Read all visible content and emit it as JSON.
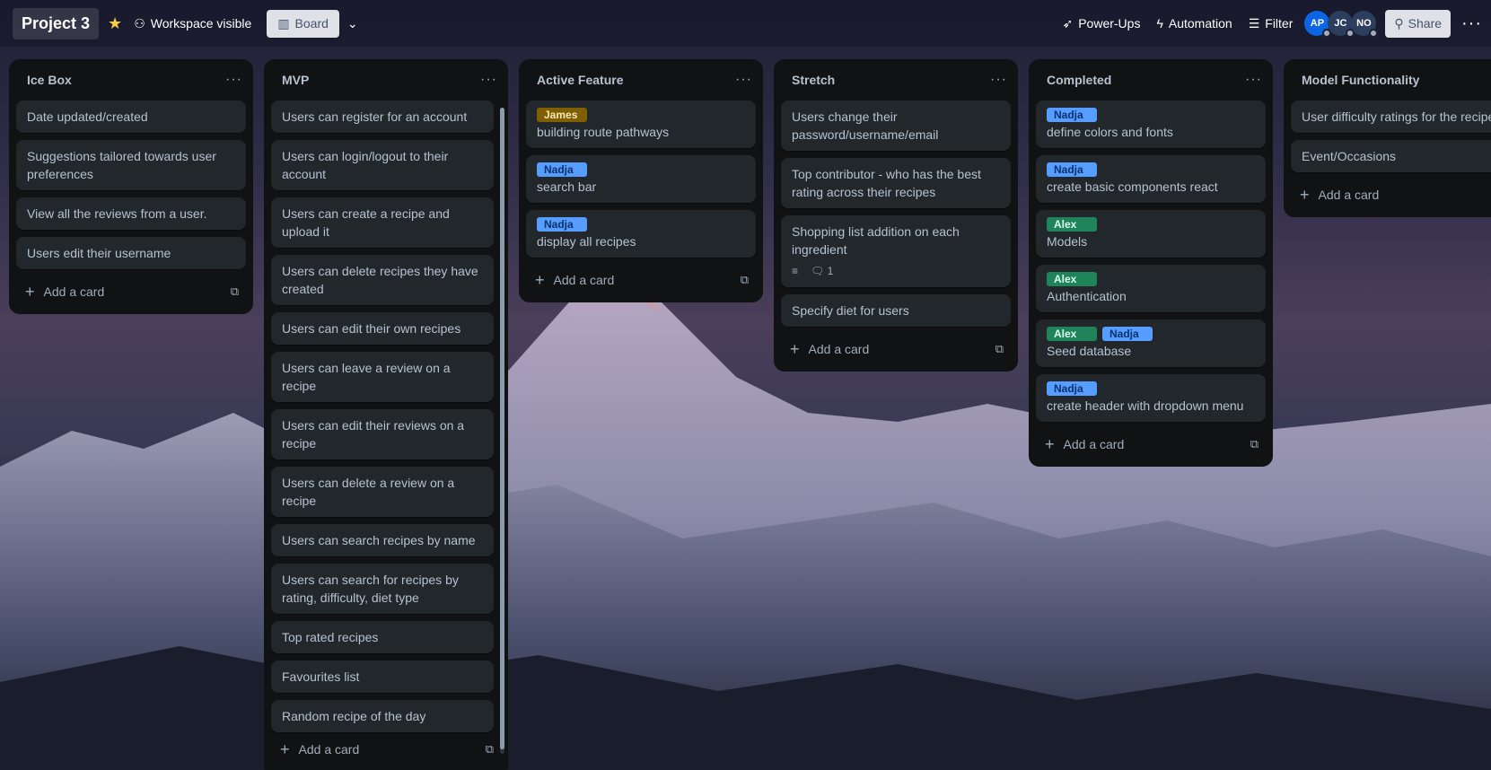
{
  "topbar": {
    "board_title": "Project 3",
    "star_icon": "star-icon",
    "visibility_label": "Workspace visible",
    "view_label": "Board",
    "powerups_label": "Power-Ups",
    "automation_label": "Automation",
    "filter_label": "Filter",
    "share_label": "Share",
    "avatars": [
      {
        "initials": "AP",
        "color": "#0c66e4"
      },
      {
        "initials": "JC",
        "color": "#2c3e5d"
      },
      {
        "initials": "NO",
        "color": "#2c3e5d"
      }
    ]
  },
  "labels": {
    "James": "#7f5f01",
    "Nadja": "#579dff",
    "Alex": "#1f845a"
  },
  "add_card_label": "Add a card",
  "lists": [
    {
      "title": "Ice Box",
      "cards": [
        {
          "text": "Date updated/created"
        },
        {
          "text": "Suggestions tailored towards user preferences"
        },
        {
          "text": "View all the reviews from a user."
        },
        {
          "text": "Users edit their username"
        }
      ]
    },
    {
      "title": "MVP",
      "cards": [
        {
          "text": "Users can register for an account"
        },
        {
          "text": "Users can login/logout to their account"
        },
        {
          "text": "Users can create a recipe and upload it"
        },
        {
          "text": "Users can delete recipes they have created"
        },
        {
          "text": "Users can edit their own recipes"
        },
        {
          "text": "Users can leave a review on a recipe"
        },
        {
          "text": "Users can edit their reviews on a recipe"
        },
        {
          "text": "Users can delete a review on a recipe"
        },
        {
          "text": "Users can search recipes by name"
        },
        {
          "text": "Users can search for recipes by rating, difficulty, diet type"
        },
        {
          "text": "Top rated recipes"
        },
        {
          "text": "Favourites list"
        },
        {
          "text": "Random recipe of the day"
        }
      ]
    },
    {
      "title": "Active Feature",
      "cards": [
        {
          "labels": [
            "James"
          ],
          "text": "building route pathways"
        },
        {
          "labels": [
            "Nadja"
          ],
          "text": "search bar"
        },
        {
          "labels": [
            "Nadja"
          ],
          "text": "display all recipes"
        }
      ]
    },
    {
      "title": "Stretch",
      "cards": [
        {
          "text": "Users change their password/username/email"
        },
        {
          "text": "Top contributor - who has the best rating across their recipes"
        },
        {
          "text": "Shopping list addition on each ingredient",
          "has_description": true,
          "comments": "1"
        },
        {
          "text": "Specify diet for users"
        }
      ]
    },
    {
      "title": "Completed",
      "cards": [
        {
          "labels": [
            "Nadja"
          ],
          "text": "define colors and fonts"
        },
        {
          "labels": [
            "Nadja"
          ],
          "text": "create basic components react"
        },
        {
          "labels": [
            "Alex"
          ],
          "text": "Models"
        },
        {
          "labels": [
            "Alex"
          ],
          "text": "Authentication"
        },
        {
          "labels": [
            "Alex",
            "Nadja"
          ],
          "text": "Seed database"
        },
        {
          "labels": [
            "Nadja"
          ],
          "text": "create header with dropdown menu"
        }
      ]
    },
    {
      "title": "Model Functionality",
      "cards": [
        {
          "text": "User difficulty ratings for the recipes"
        },
        {
          "text": "Event/Occasions"
        }
      ]
    }
  ]
}
